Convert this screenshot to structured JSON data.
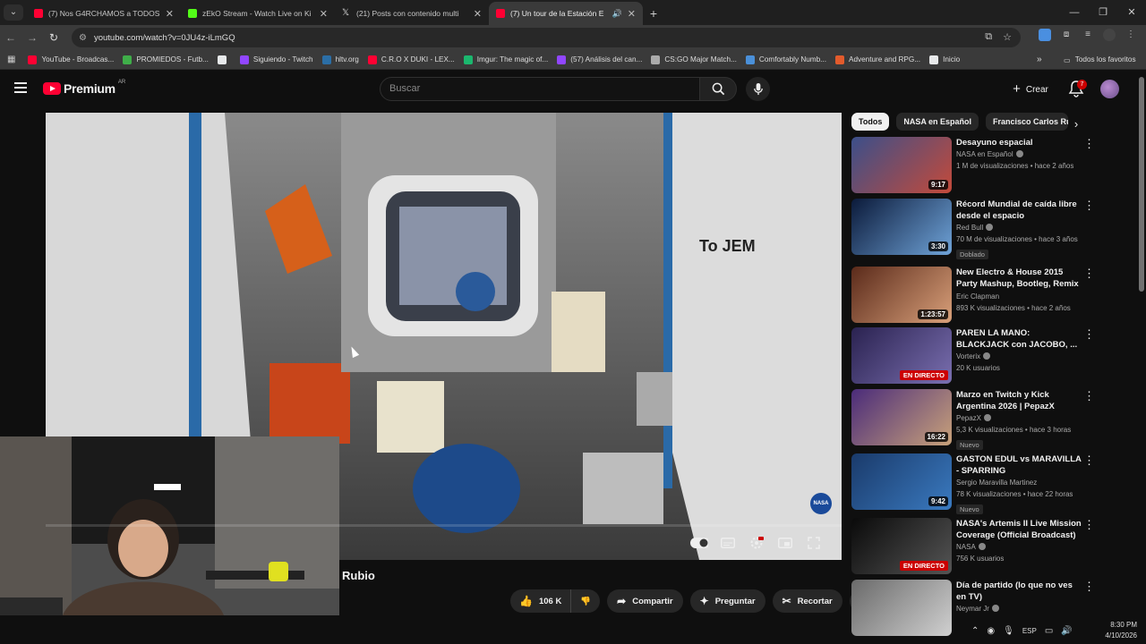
{
  "browser": {
    "tabs": [
      {
        "title": "(7) Nos G4RCHAMOS a TODOS",
        "favicon_color": "#ff0033",
        "active": false
      },
      {
        "title": "zEkO Stream - Watch Live on Ki",
        "favicon_color": "#53fc18",
        "active": false
      },
      {
        "title": "(21) Posts con contenido multi",
        "favicon_color": "#e7e9ea",
        "active": false
      },
      {
        "title": "(7) Un tour de la Estación E",
        "favicon_color": "#ff0033",
        "active": true
      }
    ],
    "url": "youtube.com/watch?v=0JU4z-iLmGQ",
    "bookmarks": [
      {
        "label": "YouTube - Broadcas...",
        "color": "#ff0033"
      },
      {
        "label": "PROMIEDOS - Futb...",
        "color": "#3fae49"
      },
      {
        "label": "",
        "color": "#e7e9ea"
      },
      {
        "label": "Siguiendo - Twitch",
        "color": "#9146ff"
      },
      {
        "label": "hltv.org",
        "color": "#2b6ea6"
      },
      {
        "label": "C.R.O X DUKI - LEX...",
        "color": "#ff0033"
      },
      {
        "label": "Imgur: The magic of...",
        "color": "#1bb76e"
      },
      {
        "label": "(57) Análisis del can...",
        "color": "#9146ff"
      },
      {
        "label": "CS:GO Major Match...",
        "color": "#aaaaaa"
      },
      {
        "label": "Comfortably Numb...",
        "color": "#4a90d9"
      },
      {
        "label": "Adventure and RPG...",
        "color": "#e35b2c"
      },
      {
        "label": "Inicio",
        "color": "#e7e9ea"
      }
    ],
    "all_bookmarks_label": "Todos los favoritos"
  },
  "youtube": {
    "logo_text": "Premium",
    "country": "AR",
    "search_placeholder": "Buscar",
    "create_label": "Crear",
    "notifications_count": "7"
  },
  "video": {
    "title": "Rubio",
    "likes": "106 K",
    "share_label": "Compartir",
    "ask_label": "Preguntar",
    "clip_label": "Recortar",
    "watermark": "NASA"
  },
  "chips": [
    "Todos",
    "NASA en Español",
    "Francisco Carlos Ru"
  ],
  "recommendations": [
    {
      "title": "Desayuno espacial",
      "channel": "NASA en Español",
      "verified": true,
      "meta": "1 M de visualizaciones • hace 2 años",
      "badge": "9:17",
      "badge_type": "duration",
      "tag": "",
      "thumb_a": "#3b4f8a",
      "thumb_b": "#c44a3a"
    },
    {
      "title": "Récord Mundial de caída libre desde el espacio",
      "channel": "Red Bull",
      "verified": true,
      "meta": "70 M de visualizaciones • hace 3 años",
      "badge": "3:30",
      "badge_type": "duration",
      "tag": "Doblado",
      "thumb_a": "#0b1a3a",
      "thumb_b": "#6fa3d8"
    },
    {
      "title": "New Electro & House 2015 Party Mashup, Bootleg, Remix ...",
      "channel": "Eric Clapman",
      "verified": false,
      "meta": "893 K visualizaciones • hace 2 años",
      "badge": "1:23:57",
      "badge_type": "duration",
      "tag": "",
      "thumb_a": "#5a2a1a",
      "thumb_b": "#d9a07a"
    },
    {
      "title": "PAREN LA MANO: BLACKJACK con JACOBO, ...",
      "channel": "Vorterix",
      "verified": true,
      "meta": "20 K usuarios",
      "badge": "EN DIRECTO",
      "badge_type": "live",
      "tag": "",
      "thumb_a": "#2a2250",
      "thumb_b": "#7a6fb0"
    },
    {
      "title": "Marzo en Twitch y Kick Argentina 2026 | PepazX",
      "channel": "PepazX",
      "verified": true,
      "meta": "5,3 K visualizaciones • hace 3 horas",
      "badge": "16:22",
      "badge_type": "duration",
      "tag": "Nuevo",
      "thumb_a": "#4a2b7a",
      "thumb_b": "#c9a27a"
    },
    {
      "title": "GASTON EDUL vs MARAVILLA - SPARRING",
      "channel": "Sergio Maravilla Martinez",
      "verified": false,
      "meta": "78 K visualizaciones • hace 22 horas",
      "badge": "9:42",
      "badge_type": "duration",
      "tag": "Nuevo",
      "thumb_a": "#1a3a6a",
      "thumb_b": "#3a7ac0"
    },
    {
      "title": "NASA's Artemis II Live Mission Coverage (Official Broadcast)",
      "channel": "NASA",
      "verified": true,
      "meta": "756 K usuarios",
      "badge": "EN DIRECTO",
      "badge_type": "live",
      "tag": "",
      "thumb_a": "#0a0a0a",
      "thumb_b": "#555555"
    },
    {
      "title": "Día de partido (lo que no ves en TV)",
      "channel": "Neymar Jr",
      "verified": true,
      "meta": "",
      "badge": "",
      "badge_type": "",
      "tag": "",
      "thumb_a": "#6a6a6a",
      "thumb_b": "#d0d0d0"
    }
  ],
  "taskbar": {
    "lang": "ESP",
    "time": "8:30 PM",
    "date": "4/10/2026"
  }
}
